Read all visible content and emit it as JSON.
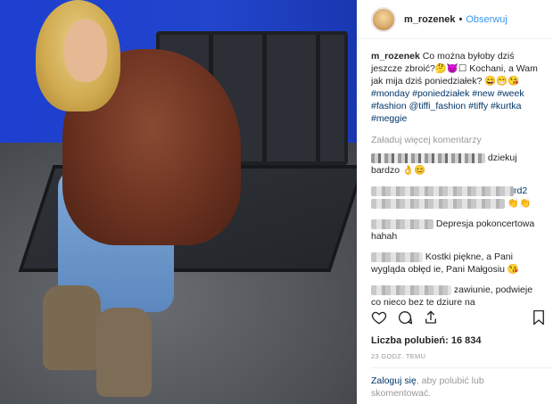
{
  "header": {
    "username": "m_rozenek",
    "dot": "•",
    "follow_label": "Obserwuj"
  },
  "caption": {
    "username": "m_rozenek",
    "text": "Co można byłoby dziś jeszcze zbroić?🤔😈☐ Kochani, a Wam jak mija dziś poniedziałek? 😄😁😘",
    "tags": "#monday #poniedziałek #new #week #fashion @tiffi_fashion #tiffy #kurtka #meggie"
  },
  "load_more": "Załaduj więcej komentarzy",
  "comments": [
    {
      "text": "dziekuj bardzo 👌😊"
    },
    {
      "text": "rd2"
    },
    {
      "text": "👏👏"
    },
    {
      "text": "Depresja pokoncertowa hahah"
    },
    {
      "text": "Kostki piękne, a Pani wygląda obłęd ie, Pani Małgosiu 😘"
    },
    {
      "text": "zawiunie, podwieje co nieco bez te dziure na"
    }
  ],
  "likes": "Liczba polubień: 16 834",
  "time": "23 GODZ. TEMU",
  "login": {
    "link": "Zaloguj się",
    "rest": ", aby polubić lub skomentować."
  },
  "icons": [
    "heart-icon",
    "comment-icon",
    "share-icon",
    "bookmark-icon"
  ],
  "colors": {
    "link_blue": "#3897f0",
    "tag_blue": "#003569",
    "muted": "#999999"
  }
}
